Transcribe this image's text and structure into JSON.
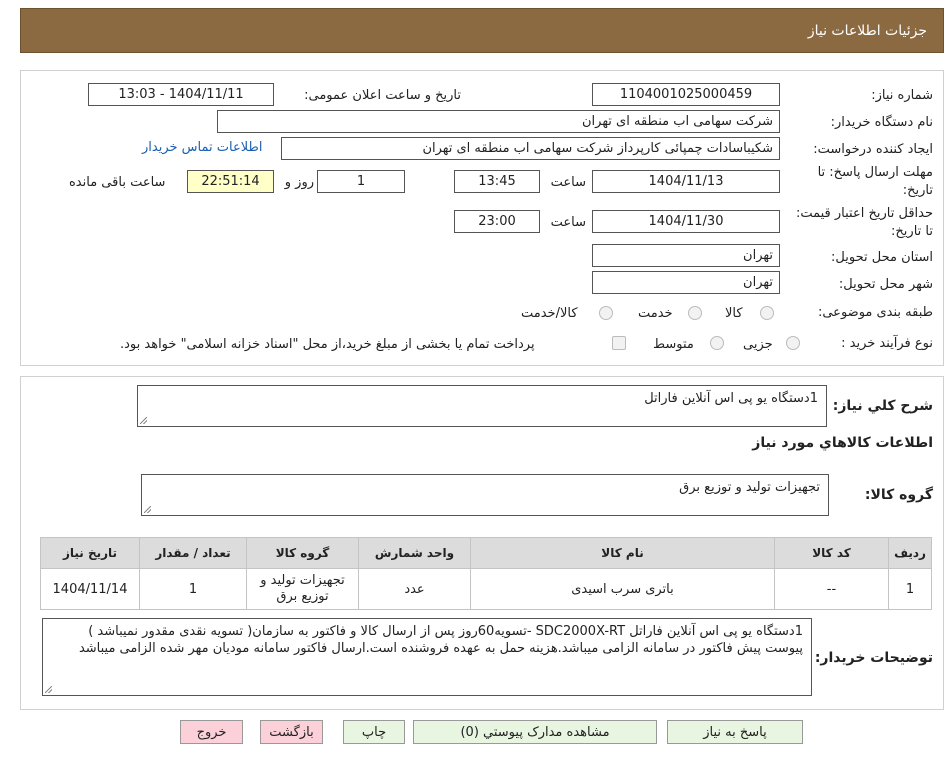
{
  "header": {
    "title": "جزئیات اطلاعات نیاز"
  },
  "form": {
    "need_number_label": "شماره نیاز:",
    "need_number": "1104001025000459",
    "announce_label": "تاریخ و ساعت اعلان عمومی:",
    "announce_value": "1404/11/11 - 13:03",
    "buyer_org_label": "نام دستگاه خریدار:",
    "buyer_org": "شرکت سهامی اب منطقه ای تهران",
    "creator_label": "ایجاد کننده درخواست:",
    "creator": "شکیباسادات چمپائی کارپرداز شرکت سهامی اب منطقه ای تهران",
    "contact_link": "اطلاعات تماس خریدار",
    "reply_deadline_label": "مهلت ارسال پاسخ: تا تاریخ:",
    "reply_date": "1404/11/13",
    "hour_label": "ساعت",
    "reply_time": "13:45",
    "days_value": "1",
    "days_label": "روز و",
    "remaining_time": "22:51:14",
    "remaining_label": "ساعت باقی مانده",
    "validity_label": "حداقل تاریخ اعتبار قیمت: تا تاریخ:",
    "validity_date": "1404/11/30",
    "validity_time": "23:00",
    "province_label": "استان محل تحویل:",
    "province": "تهران",
    "city_label": "شهر محل تحویل:",
    "city": "تهران",
    "category_label": "طبقه بندی موضوعی:",
    "category_options": [
      "کالا",
      "خدمت",
      "کالا/خدمت"
    ],
    "process_label": "نوع فرآیند خرید :",
    "process_options": [
      "جزیی",
      "متوسط"
    ],
    "payment_note": "پرداخت تمام یا بخشی از مبلغ خرید،از محل \"اسناد خزانه اسلامی\" خواهد بود."
  },
  "details": {
    "summary_label": "شرح کلي نياز:",
    "summary": "1دستگاه یو پی اس آنلاین فاراتل",
    "goods_info_title": "اطلاعات کالاهاي مورد نياز",
    "goods_group_label": "گروه کالا:",
    "goods_group": "تجهیزات تولید و توزیع برق",
    "table": {
      "headers": [
        "رديف",
        "کد کالا",
        "نام کالا",
        "واحد شمارش",
        "گروه کالا",
        "تعداد / مقدار",
        "تاريخ نياز"
      ],
      "rows": [
        [
          "1",
          "--",
          "باتری سرب اسیدی",
          "عدد",
          "تجهیزات تولید و توزیع برق",
          "1",
          "1404/11/14"
        ]
      ]
    },
    "buyer_notes_label": "توضيحات خريدار:",
    "buyer_notes": "1دستگاه یو پی اس آنلاین فاراتل SDC2000X-RT -تسویه60روز پس از ارسال کالا و فاکتور به سازمان( تسویه نقدی مقدور نمیباشد ) پیوست پیش فاکتور در سامانه  الزامی  میباشد.هزینه حمل به عهده فروشنده است.ارسال فاکتور سامانه مودیان مهر شده الزامی میباشد"
  },
  "buttons": {
    "reply": "پاسخ به نياز",
    "attachments": "مشاهده مدارک پيوستي (0)",
    "print": "چاپ",
    "back": "بازگشت",
    "exit": "خروج"
  },
  "watermark": {
    "text": "AriaTender.neT"
  },
  "colors": {
    "header": "#8b6a42",
    "table_header": "#dcdcdc",
    "green_button": "#e8f5e1",
    "pink_button": "#fbd0d8",
    "link": "#1a5fb4"
  }
}
